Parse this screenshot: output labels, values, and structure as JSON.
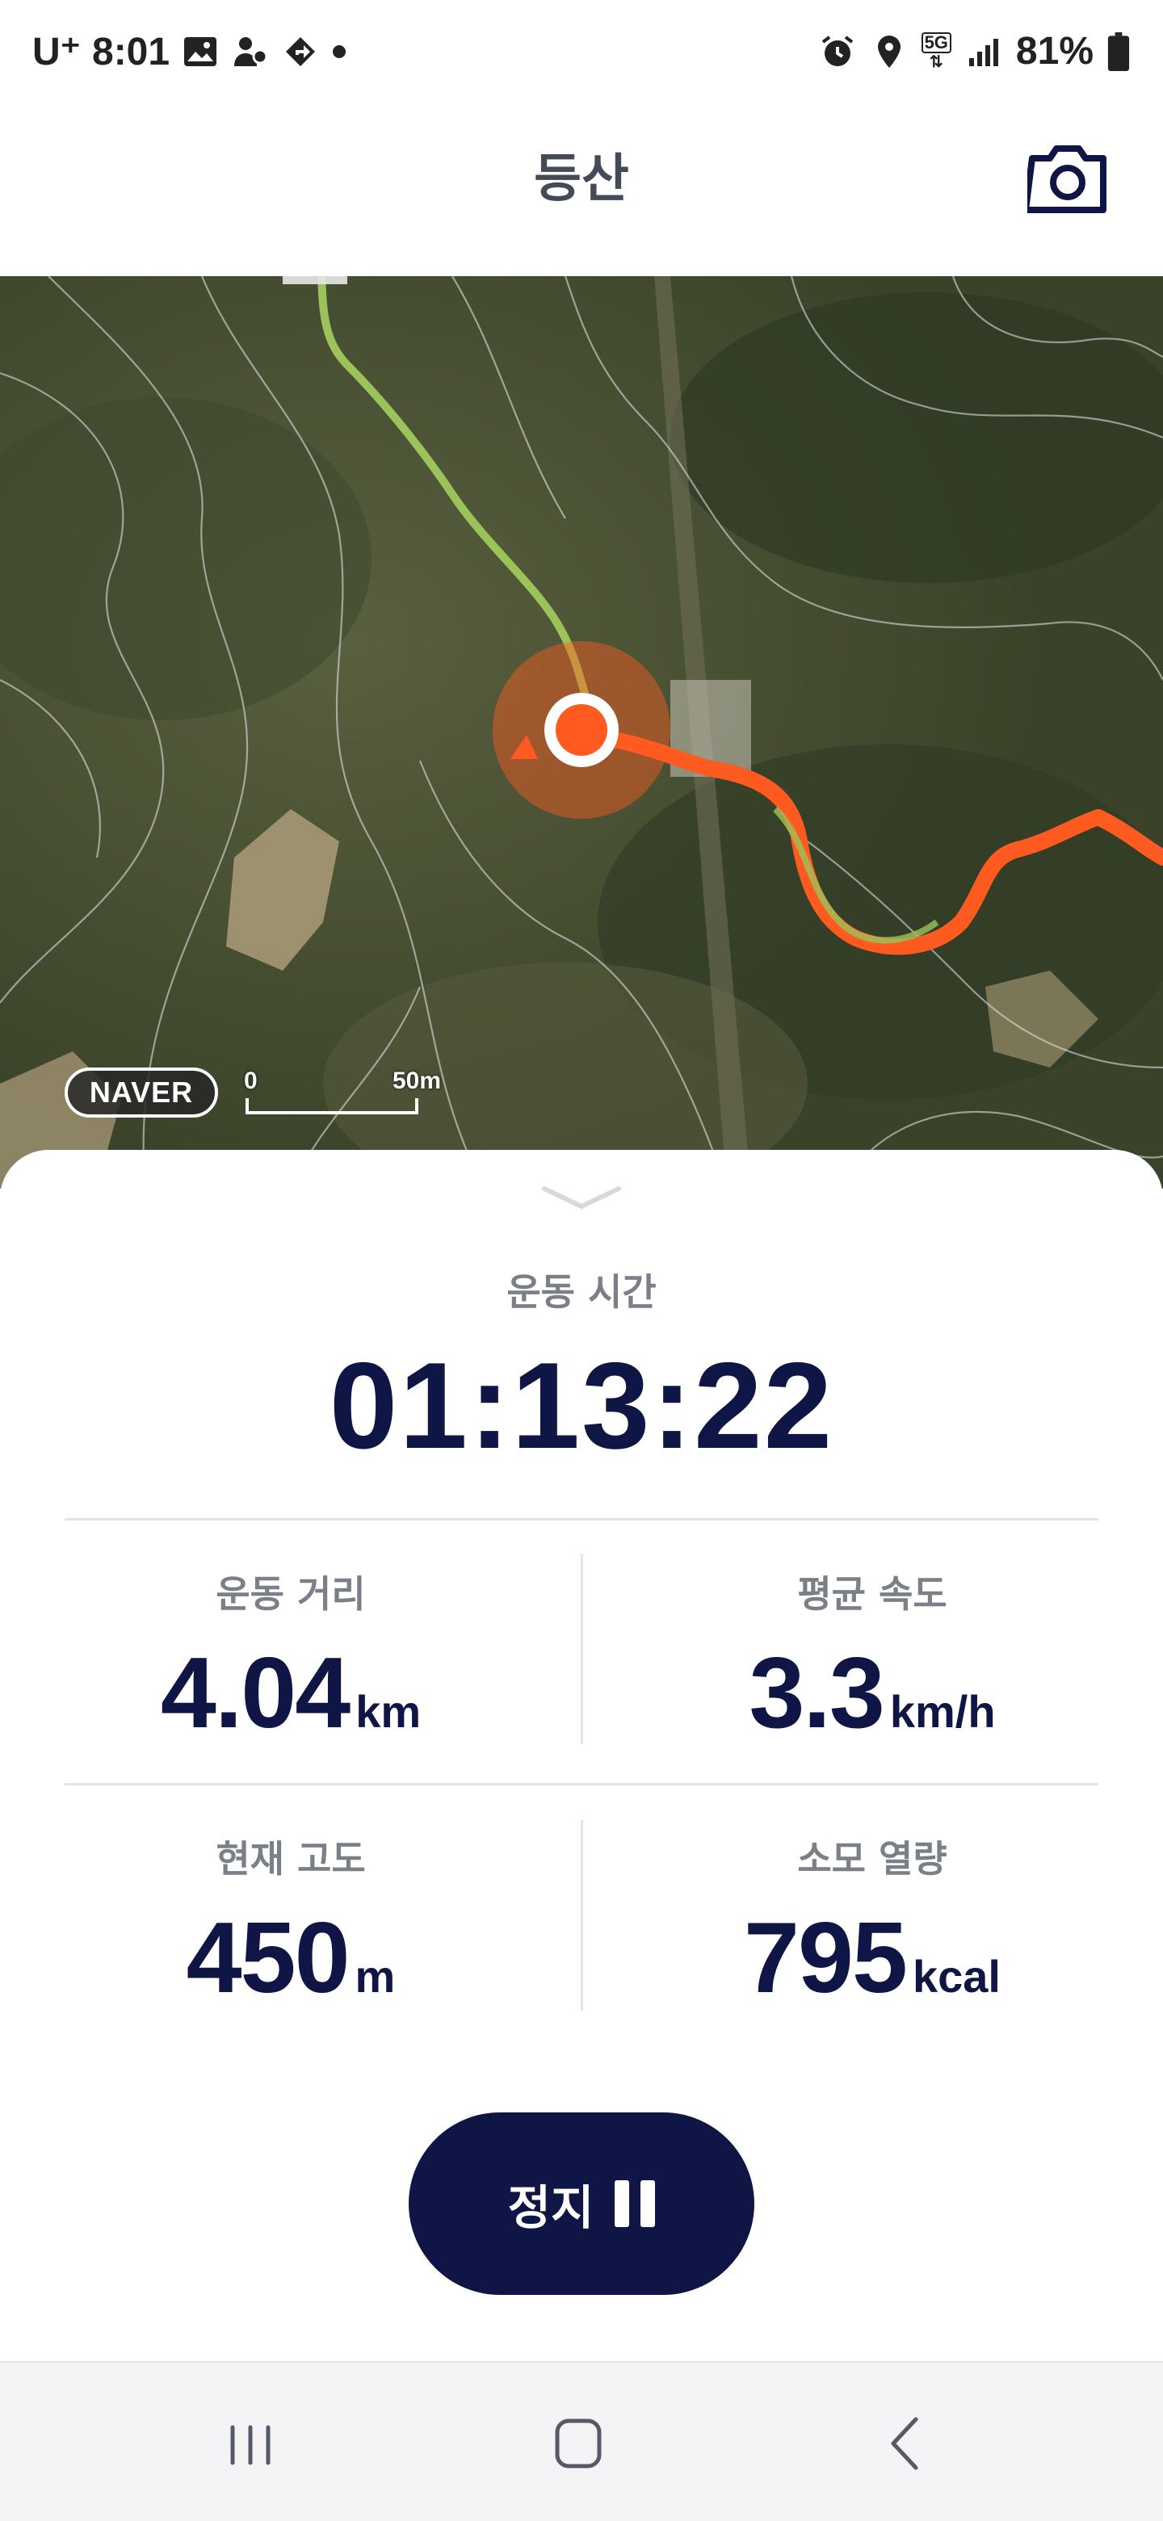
{
  "status_bar": {
    "carrier": "U⁺",
    "time": "8:01",
    "network": "5G",
    "battery": "81%",
    "icons": [
      "gallery-icon",
      "person-location-icon",
      "navigation-icon",
      "dot-icon",
      "alarm-icon",
      "location-icon",
      "5g-icon",
      "signal-icon",
      "battery-icon"
    ]
  },
  "header": {
    "title": "등산",
    "camera_icon": "camera-icon"
  },
  "map": {
    "provider_logo": "NAVER",
    "scale_start": "0",
    "scale_end": "50m",
    "route_color": "#ff5a1f",
    "planned_route_color": "#9bc35a"
  },
  "workout": {
    "time_label": "운동 시간",
    "time_value": "01:13:22",
    "stats": [
      {
        "label": "운동 거리",
        "value": "4.04",
        "unit": "km"
      },
      {
        "label": "평균 속도",
        "value": "3.3",
        "unit": "km/h"
      },
      {
        "label": "현재 고도",
        "value": "450",
        "unit": "m"
      },
      {
        "label": "소모 열량",
        "value": "795",
        "unit": "kcal"
      }
    ],
    "stop_label": "정지"
  },
  "nav": {
    "icons": [
      "recent-apps-icon",
      "home-icon",
      "back-icon"
    ]
  },
  "colors": {
    "accent": "#0f1646",
    "route": "#ff5a1f"
  }
}
